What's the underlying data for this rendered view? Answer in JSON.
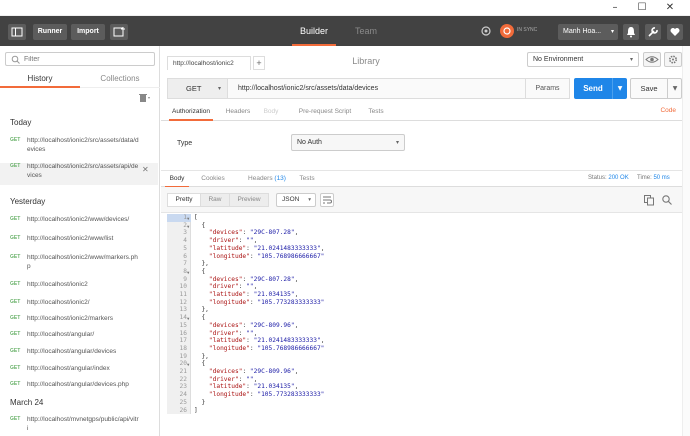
{
  "window": {
    "minimize": "–",
    "maximize": "☐",
    "close": "✕"
  },
  "header": {
    "runner_label": "Runner",
    "import_label": "Import",
    "modes": [
      "Builder",
      "Team Library"
    ],
    "sync_label": "IN SYNC",
    "user_label": "Manh Hoa...",
    "accent_color": "#f26b3a"
  },
  "sidebar": {
    "search_placeholder": "Filter",
    "tabs": [
      "History",
      "Collections"
    ],
    "sections": [
      {
        "title": "Today",
        "items": [
          {
            "method": "GET",
            "url": "http://localhost/ionic2/src/assets/data/devices"
          },
          {
            "method": "GET",
            "url": "http://localhost/ionic2/src/assets/api/devices"
          }
        ]
      },
      {
        "title": "Yesterday",
        "items": [
          {
            "method": "GET",
            "url": "http://localhost/ionic2/www/devices/"
          },
          {
            "method": "GET",
            "url": "http://localhost/ionic2/www/list"
          },
          {
            "method": "GET",
            "url": "http://localhost/ionic2/www/markers.php"
          },
          {
            "method": "GET",
            "url": "http://localhost/ionic2"
          },
          {
            "method": "GET",
            "url": "http://localhost/ionic2/"
          },
          {
            "method": "GET",
            "url": "http://localhost/ionic2/markers"
          },
          {
            "method": "GET",
            "url": "http://localhost/angular/"
          },
          {
            "method": "GET",
            "url": "http://localhost/angular/devices"
          },
          {
            "method": "GET",
            "url": "http://localhost/angular/index"
          },
          {
            "method": "GET",
            "url": "http://localhost/angular/devices.php"
          }
        ]
      },
      {
        "title": "March 24",
        "items": [
          {
            "method": "GET",
            "url": "http://localhost/mvnetgps/public/api/vitri"
          }
        ]
      }
    ]
  },
  "request": {
    "tab_label": "http://localhost/ionic2",
    "environment": "No Environment",
    "method": "GET",
    "url": "http://localhost/ionic2/src/assets/data/devices",
    "params_label": "Params",
    "send_label": "Send",
    "save_label": "Save",
    "subtabs": [
      "Authorization",
      "Headers",
      "Body",
      "Pre-request Script",
      "Tests"
    ],
    "code_link": "Code",
    "auth_type_label": "Type",
    "auth_type_value": "No Auth"
  },
  "response": {
    "tabs": {
      "body": "Body",
      "cookies": "Cookies",
      "headers": "Headers",
      "headers_count": "(13)",
      "tests": "Tests"
    },
    "status_label": "Status:",
    "status_value": "200 OK",
    "time_label": "Time:",
    "time_value": "50 ms",
    "formats": [
      "Pretty",
      "Raw",
      "Preview"
    ],
    "format_type": "JSON",
    "lines": [
      "[",
      "  {",
      "    \"devices\": \"29C-807.28\",",
      "    \"driver\": \"\",",
      "    \"latitude\": \"21.0241483333333\",",
      "    \"longitude\": \"105.768986666667\"",
      "  },",
      "  {",
      "    \"devices\": \"29C-807.28\",",
      "    \"driver\": \"\",",
      "    \"latitude\": \"21.034135\",",
      "    \"longitude\": \"105.773283333333\"",
      "  },",
      "  {",
      "    \"devices\": \"29C-809.96\",",
      "    \"driver\": \"\",",
      "    \"latitude\": \"21.0241483333333\",",
      "    \"longitude\": \"105.768986666667\"",
      "  },",
      "  {",
      "    \"devices\": \"29C-809.96\",",
      "    \"driver\": \"\",",
      "    \"latitude\": \"21.034135\",",
      "    \"longitude\": \"105.773283333333\"",
      "  }",
      "]"
    ],
    "fold_lines": [
      1,
      2,
      8,
      14,
      20
    ]
  }
}
